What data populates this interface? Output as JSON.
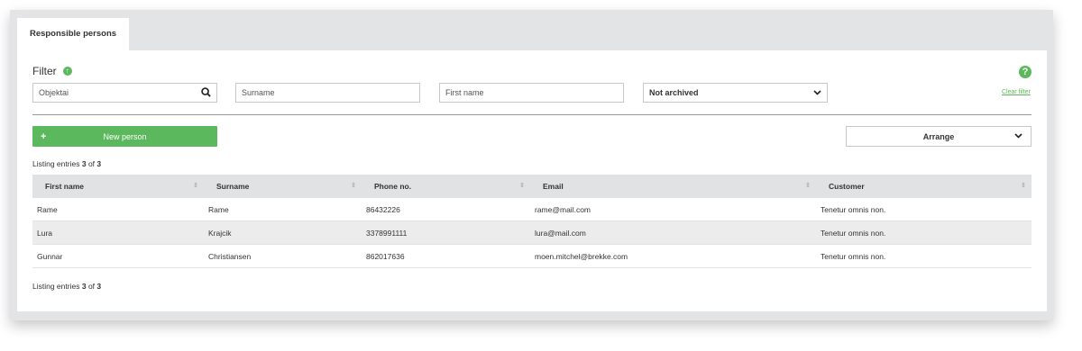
{
  "tabs": [
    {
      "label": "Responsible persons"
    }
  ],
  "filter": {
    "title": "Filter",
    "objekt_placeholder": "Objektai",
    "surname_placeholder": "Surname",
    "firstname_placeholder": "First name",
    "archived_select": "Not archived",
    "clear_label": "Clear filter"
  },
  "actions": {
    "new_person_label": "New person",
    "arrange_label": "Arrange"
  },
  "listing": {
    "prefix": "Listing entries",
    "shown": "3",
    "of": "of",
    "total": "3"
  },
  "table": {
    "columns": [
      "First name",
      "Surname",
      "Phone no.",
      "Email",
      "Customer"
    ],
    "rows": [
      [
        "Rame",
        "Rame",
        "86432226",
        "rame@mail.com",
        "Tenetur omnis non."
      ],
      [
        "Lura",
        "Krajcik",
        "3378991111",
        "lura@mail.com",
        "Tenetur omnis non."
      ],
      [
        "Gunnar",
        "Christiansen",
        "862017636",
        "moen.mitchel@brekke.com",
        "Tenetur omnis non."
      ]
    ]
  },
  "colors": {
    "accent": "#5cb85c",
    "header_bg": "#e1e2e4",
    "alt_row": "#ececed"
  }
}
